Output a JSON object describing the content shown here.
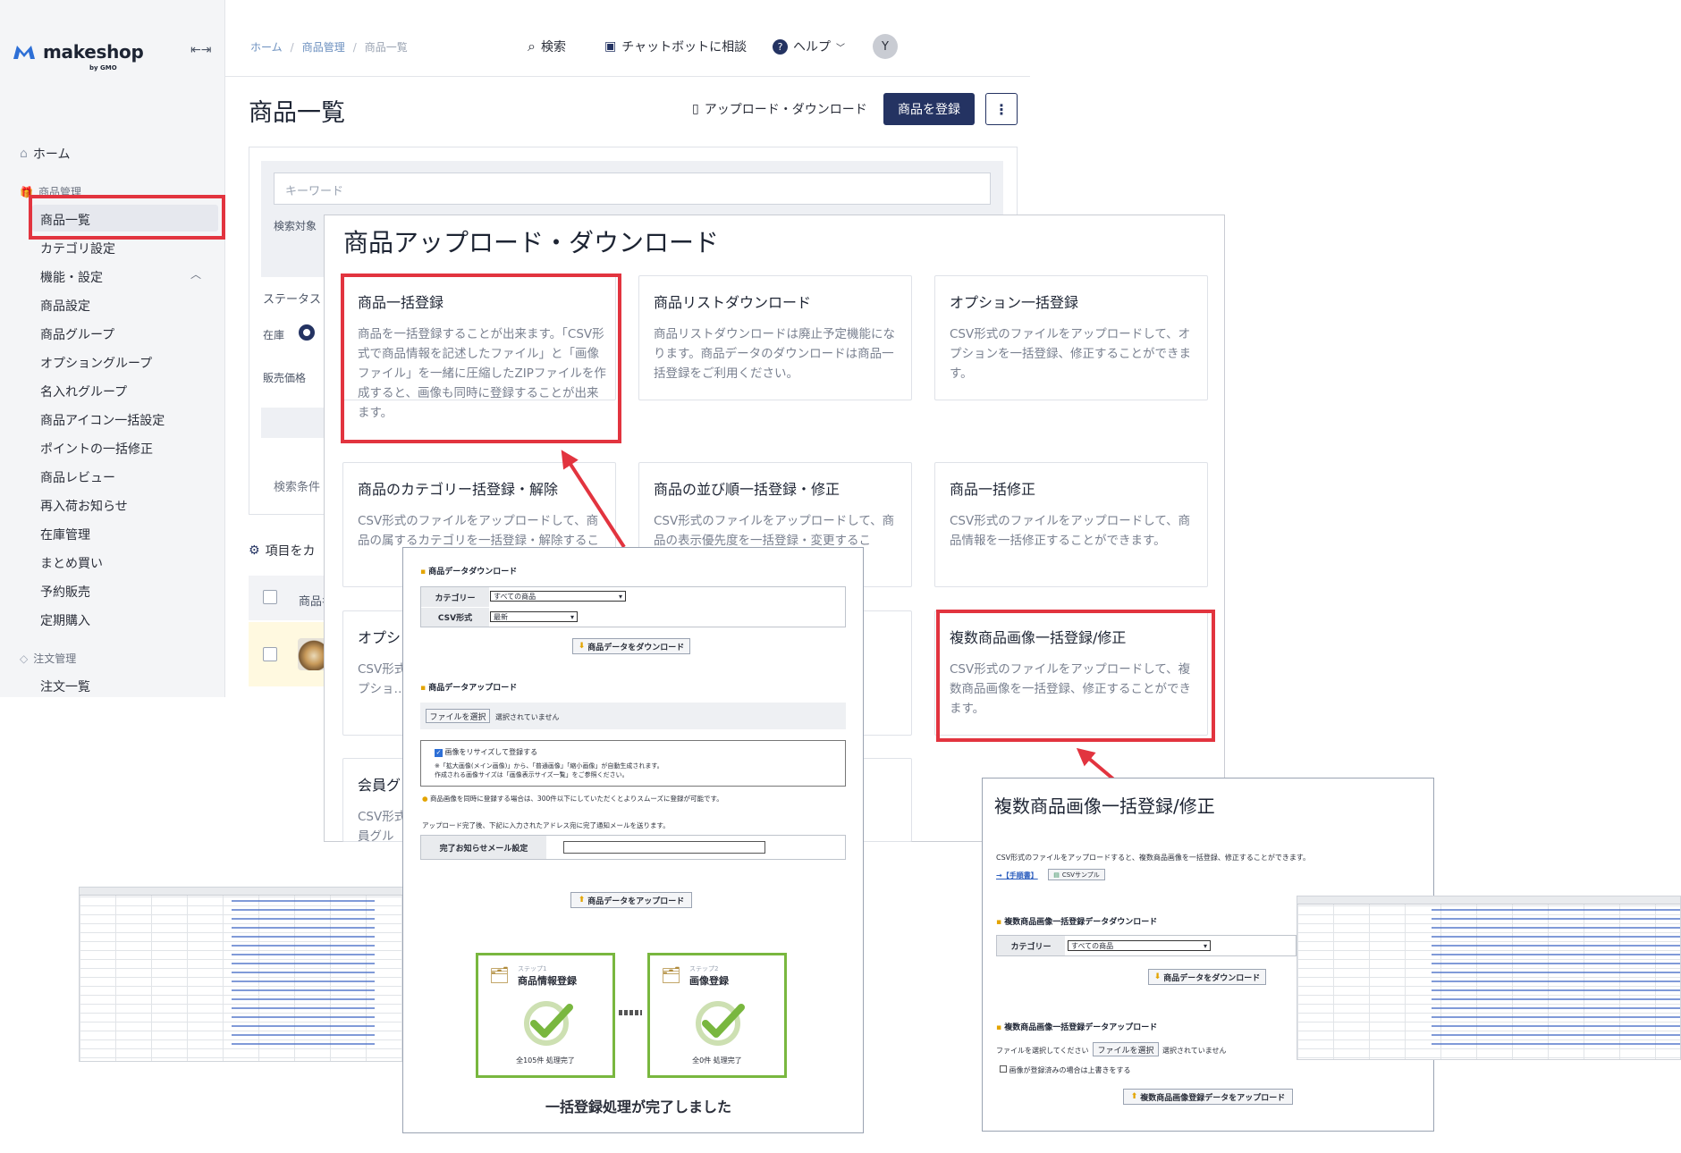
{
  "brand": {
    "name": "makeshop",
    "sub": "by GMO"
  },
  "sidebar": {
    "home": "ホーム",
    "group_products": "商品管理",
    "items": [
      "商品一覧",
      "カテゴリ設定",
      "機能・設定",
      "商品設定",
      "商品グループ",
      "オプショングループ",
      "名入れグループ",
      "商品アイコン一括設定",
      "ポイントの一括修正",
      "商品レビュー",
      "再入荷お知らせ",
      "在庫管理",
      "まとめ買い",
      "予約販売",
      "定期購入"
    ],
    "group_orders": "注文管理",
    "orders_item": "注文一覧"
  },
  "breadcrumb": [
    "ホーム",
    "商品管理",
    "商品一覧"
  ],
  "topbar": {
    "search": "検索",
    "chatbot": "チャットボットに相談",
    "help": "ヘルプ",
    "avatar": "Y"
  },
  "page": {
    "title": "商品一覧",
    "upload_download": "アップロード・ダウンロード",
    "register_button": "商品を登録"
  },
  "search": {
    "keyword_placeholder": "キーワード",
    "target_label": "検索対象",
    "status_label": "ステータス",
    "stock_label": "在庫",
    "price_label": "販売価格",
    "conditions_label": "検索条件",
    "customize_label": "項目をカ",
    "col_label": "商品名"
  },
  "modal": {
    "title": "商品アップロード・ダウンロード",
    "cards": [
      {
        "title": "商品一括登録",
        "desc": "商品を一括登録することが出来ます。「CSV形式で商品情報を記述したファイル」と「画像ファイル」を一緒に圧縮したZIPファイルを作成すると、画像も同時に登録することが出来ます。"
      },
      {
        "title": "商品リストダウンロード",
        "desc": "商品リストダウンロードは廃止予定機能になります。商品データのダウンロードは商品一括登録をご利用ください。"
      },
      {
        "title": "オプション一括登録",
        "desc": "CSV形式のファイルをアップロードして、オプションを一括登録、修正することができます。"
      },
      {
        "title": "商品のカテゴリー括登録・解除",
        "desc": "CSV形式のファイルをアップロードして、商品の属するカテゴリを一括登録・解除するこ"
      },
      {
        "title": "商品の並び順一括登録・修正",
        "desc": "CSV形式のファイルをアップロードして、商品の表示優先度を一括登録・変更するこ"
      },
      {
        "title": "商品一括修正",
        "desc": "CSV形式のファイルをアップロードして、商品情報を一括修正することができます。"
      },
      {
        "title": "オプシ",
        "desc": "CSV形式のファイルをアップロードして、オプショ…ます。"
      },
      {
        "title": "複数商品画像一括登録/修正",
        "desc": "CSV形式のファイルをアップロードして、複数商品画像を一括登録、修正することができます。"
      },
      {
        "title": "会員グ",
        "desc": "CSV形式のファイルをアップロードして、会員グル"
      }
    ]
  },
  "bulk_screen": {
    "download_title": "商品データダウンロード",
    "category_label": "カテゴリー",
    "category_value": "すべての商品",
    "csv_label": "CSV形式",
    "csv_value": "最新",
    "download_button": "商品データをダウンロード",
    "upload_title": "商品データアップロード",
    "file_button": "ファイルを選択",
    "file_status": "選択されていません",
    "resize_label": "画像をリサイズして登録する",
    "resize_note1": "※「拡大画像(メイン画像)」から、「普通画像」「縮小画像」が自動生成されます。",
    "resize_note2": "作成される画像サイズは「画像表示サイズ一覧」をご参照ください。",
    "warn_note": "商品画像を同時に登録する場合は、300件以下にしていただくとよりスムーズに登録が可能です。",
    "mail_note": "アップロード完了後、下記に入力されたアドレス宛に完了通知メールを送ります。",
    "mail_label": "完了お知らせメール設定",
    "upload_button": "商品データをアップロード",
    "step1_small": "ステップ1",
    "step1_name": "商品情報登録",
    "step1_count": "全105件 処理完了",
    "step2_small": "ステップ2",
    "step2_name": "画像登録",
    "step2_count": "全0件 処理完了",
    "done": "一括登録処理が完了しました"
  },
  "multi_image": {
    "title": "複数商品画像一括登録/修正",
    "desc": "CSV形式のファイルをアップロードすると、複数商品画像を一括登録、修正することができます。",
    "manual": "→【手順書】",
    "csv_sample": "CSVサンプル",
    "download_title": "複数商品画像一括登録データダウンロード",
    "category_label": "カテゴリー",
    "category_value": "すべての商品",
    "download_button": "商品データをダウンロード",
    "upload_title": "複数商品画像一括登録データアップロード",
    "file_prompt": "ファイルを選択してください",
    "file_button": "ファイルを選択",
    "file_status": "選択されていません",
    "overwrite": "画像が登録済みの場合は上書きをする",
    "upload_button": "複数商品画像登録データをアップロード"
  },
  "colors": {
    "navy": "#243362",
    "highlight": "#e2343f",
    "step_green": "#79b73f"
  }
}
